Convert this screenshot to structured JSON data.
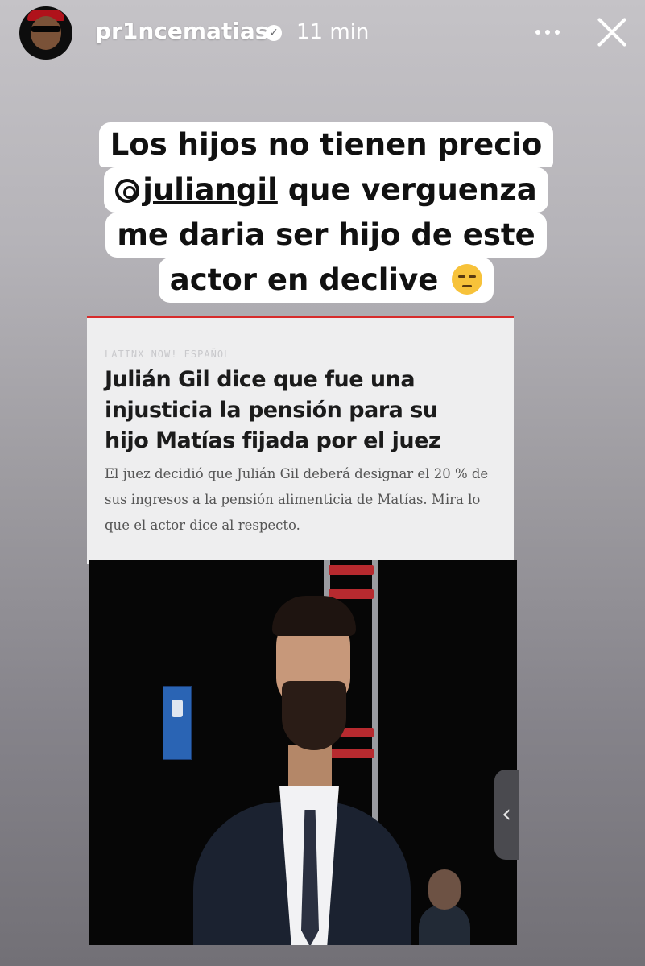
{
  "header": {
    "username": "pr1ncematias",
    "verified_icon": "verified-badge-icon",
    "time": "11 min",
    "more_icon": "more-options-icon",
    "close_icon": "close-icon"
  },
  "caption": {
    "line1": "Los hijos no tienen precio",
    "mention": "juliangil",
    "line2_rest": " que verguenza",
    "line3": "me daria ser hijo de este",
    "line4": "actor en declive",
    "emoji": "pensive-face-emoji"
  },
  "article": {
    "kicker": "LATINX NOW! ESPAÑOL",
    "headline": "Julián Gil dice que fue una injusticia la pensión para su hijo Matías fijada por el juez",
    "summary": "El juez decidió que Julián Gil deberá designar el 20 % de sus ingresos a la pensión alimenticia de Matías. Mira lo que el actor dice al respecto.",
    "accent_color": "#d72b2b"
  },
  "side_handle": {
    "label": "‹"
  }
}
